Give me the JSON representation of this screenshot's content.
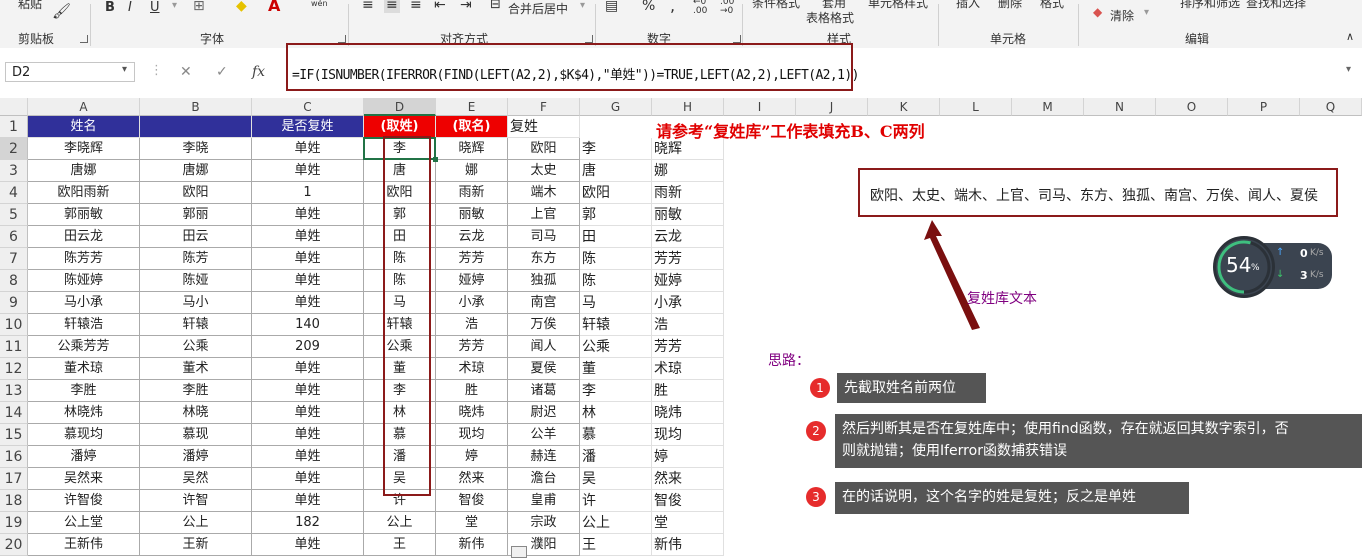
{
  "ribbon": {
    "paste": "粘贴",
    "bold": "B",
    "italic": "I",
    "underline": "U",
    "wen": "wén",
    "merge_center": "合并后居中",
    "percent": "%",
    "comma": ",",
    "cond_format": "条件格式",
    "table_format": "表格格式",
    "cell_style": "单元格样式",
    "insert": "插入",
    "delete": "删除",
    "format": "格式",
    "clear": "清除",
    "sort_filter": "排序和筛选",
    "find_select": "查找和选择",
    "groups": {
      "clipboard": "剪贴板",
      "font": "字体",
      "align": "对齐方式",
      "number": "数字",
      "style": "样式",
      "cells": "单元格",
      "edit": "编辑"
    }
  },
  "formula_bar": {
    "name_box": "D2",
    "fx": "fx",
    "formula": "=IF(ISNUMBER(IFERROR(FIND(LEFT(A2,2),$K$4),\"单姓\"))=TRUE,LEFT(A2,2),LEFT(A2,1))"
  },
  "columns": [
    "A",
    "B",
    "C",
    "D",
    "E",
    "F",
    "G",
    "H",
    "I",
    "J",
    "K",
    "L",
    "M",
    "N",
    "O",
    "P",
    "Q"
  ],
  "rows": [
    "1",
    "2",
    "3",
    "4",
    "5",
    "6",
    "7",
    "8",
    "9",
    "10",
    "11",
    "12",
    "13",
    "14",
    "15",
    "16",
    "17",
    "18",
    "19",
    "20"
  ],
  "headers": {
    "a": "姓名",
    "c": "是否复姓",
    "d": "(取姓)",
    "e": "(取名)",
    "f": "复姓"
  },
  "data": [
    [
      "李晓辉",
      "李晓",
      "单姓",
      "李",
      "晓辉",
      "欧阳",
      "李",
      "晓辉"
    ],
    [
      "唐娜",
      "唐娜",
      "单姓",
      "唐",
      "娜",
      "太史",
      "唐",
      "娜"
    ],
    [
      "欧阳雨新",
      "欧阳",
      "1",
      "欧阳",
      "雨新",
      "端木",
      "欧阳",
      "雨新"
    ],
    [
      "郭丽敏",
      "郭丽",
      "单姓",
      "郭",
      "丽敏",
      "上官",
      "郭",
      "丽敏"
    ],
    [
      "田云龙",
      "田云",
      "单姓",
      "田",
      "云龙",
      "司马",
      "田",
      "云龙"
    ],
    [
      "陈芳芳",
      "陈芳",
      "单姓",
      "陈",
      "芳芳",
      "东方",
      "陈",
      "芳芳"
    ],
    [
      "陈娅婷",
      "陈娅",
      "单姓",
      "陈",
      "娅婷",
      "独孤",
      "陈",
      "娅婷"
    ],
    [
      "马小承",
      "马小",
      "单姓",
      "马",
      "小承",
      "南宫",
      "马",
      "小承"
    ],
    [
      "轩辕浩",
      "轩辕",
      "140",
      "轩辕",
      "浩",
      "万俟",
      "轩辕",
      "浩"
    ],
    [
      "公乘芳芳",
      "公乘",
      "209",
      "公乘",
      "芳芳",
      "闻人",
      "公乘",
      "芳芳"
    ],
    [
      "董术琼",
      "董术",
      "单姓",
      "董",
      "术琼",
      "夏侯",
      "董",
      "术琼"
    ],
    [
      "李胜",
      "李胜",
      "单姓",
      "李",
      "胜",
      "诸葛",
      "李",
      "胜"
    ],
    [
      "林晓炜",
      "林晓",
      "单姓",
      "林",
      "晓炜",
      "尉迟",
      "林",
      "晓炜"
    ],
    [
      "慕现均",
      "慕现",
      "单姓",
      "慕",
      "现均",
      "公羊",
      "慕",
      "现均"
    ],
    [
      "潘婷",
      "潘婷",
      "单姓",
      "潘",
      "婷",
      "赫连",
      "潘",
      "婷"
    ],
    [
      "吴然来",
      "吴然",
      "单姓",
      "吴",
      "然来",
      "澹台",
      "吴",
      "然来"
    ],
    [
      "许智俊",
      "许智",
      "单姓",
      "许",
      "智俊",
      "皇甫",
      "许",
      "智俊"
    ],
    [
      "公上堂",
      "公上",
      "182",
      "公上",
      "堂",
      "宗政",
      "公上",
      "堂"
    ],
    [
      "王新伟",
      "王新",
      "单姓",
      "王",
      "新伟",
      "濮阳",
      "王",
      "新伟"
    ]
  ],
  "title": "请参考“复姓库”工作表填充B、C两列",
  "k4_text": "欧阳、太史、端木、上官、司马、东方、独孤、南宫、万俟、闻人、夏侯",
  "arrow_label": "复姓库文本",
  "idea_label": "思路：",
  "steps": [
    {
      "num": "1",
      "text": "先截取姓名前两位"
    },
    {
      "num": "2",
      "text": "然后判断其是否在复姓库中；使用find函数，存在就返回其数字索引，否",
      "text2": "则就抛错；使用Iferror函数捕获错误"
    },
    {
      "num": "3",
      "text": "在的话说明，这个名字的姓是复姓；反之是单姓"
    }
  ],
  "monitor": {
    "percent": "54",
    "pct_sign": "%",
    "up": "0",
    "down": "3",
    "unit": "K/s"
  },
  "colors": {
    "header_blue": "#30309a",
    "header_red": "#ee0000",
    "title_red": "#e00000",
    "box_border": "#8b1a1a",
    "purple": "#800080"
  }
}
